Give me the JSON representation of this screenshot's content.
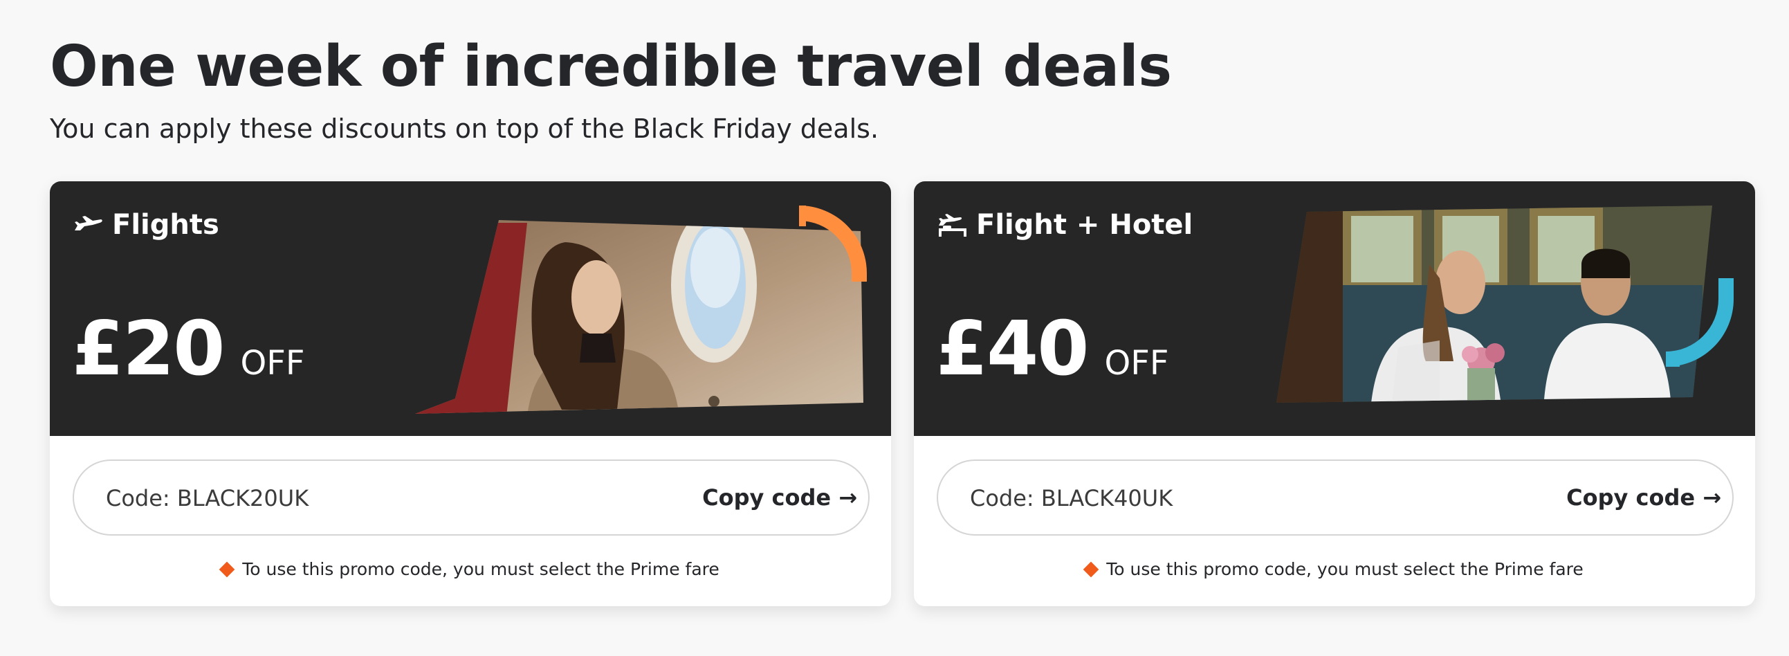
{
  "header": {
    "title": "One week of incredible travel deals",
    "subtitle": "You can apply these discounts on top of the Black Friday deals."
  },
  "cards": [
    {
      "category": "Flights",
      "icon": "plane-icon",
      "amount": "£20",
      "off_label": "OFF",
      "code_text": "Code: BLACK20UK",
      "copy_label": "Copy code →",
      "note": "To use this promo code, you must select the Prime fare",
      "accent_color": "#ff8f3f"
    },
    {
      "category": "Flight + Hotel",
      "icon": "plane-hotel-icon",
      "amount": "£40",
      "off_label": "OFF",
      "code_text": "Code: BLACK40UK",
      "copy_label": "Copy code →",
      "note": "To use this promo code, you must select the Prime fare",
      "accent_color": "#39b6d6"
    }
  ],
  "colors": {
    "card_dark": "#262626",
    "note_diamond": "#f05a1a",
    "background": "#f8f8f8"
  }
}
